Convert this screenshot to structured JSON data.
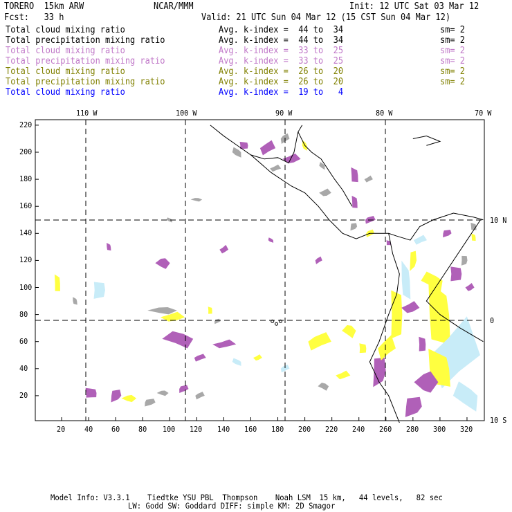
{
  "header": {
    "model": "TORERO  15km ARW",
    "org": "NCAR/MMM",
    "init": "Init: 12 UTC Sat 03 Mar 12",
    "fcst": "Fcst:   33 h",
    "valid": "Valid: 21 UTC Sun 04 Mar 12 (15 CST Sun 04 Mar 12)"
  },
  "legend": [
    {
      "field": "Total cloud mixing ratio",
      "range": "Avg. k-index =  44 to  34",
      "sm": "sm= 2",
      "color": "#000000"
    },
    {
      "field": "Total precipitation mixing ratio",
      "range": "Avg. k-index =  44 to  34",
      "sm": "sm= 2",
      "color": "#000000"
    },
    {
      "field": "Total cloud mixing ratio",
      "range": "Avg. k-index =  33 to  25",
      "sm": "sm= 2",
      "color": "#c078c8"
    },
    {
      "field": "Total precipitation mixing ratio",
      "range": "Avg. k-index =  33 to  25",
      "sm": "sm= 2",
      "color": "#c078c8"
    },
    {
      "field": "Total cloud mixing ratio",
      "range": "Avg. k-index =  26 to  20",
      "sm": "sm= 2",
      "color": "#808000"
    },
    {
      "field": "Total precipitation mixing ratio",
      "range": "Avg. k-index =  26 to  20",
      "sm": "sm= 2",
      "color": "#808000"
    },
    {
      "field": "Total cloud mixing ratio",
      "range": "Avg. k-index =  19 to   4",
      "sm": "",
      "color": "#0000ff"
    }
  ],
  "axes": {
    "x_ticks": [
      "20",
      "40",
      "60",
      "80",
      "100",
      "120",
      "140",
      "160",
      "180",
      "200",
      "220",
      "240",
      "260",
      "280",
      "300",
      "320"
    ],
    "y_ticks": [
      "20",
      "40",
      "60",
      "80",
      "100",
      "120",
      "140",
      "160",
      "180",
      "200",
      "220"
    ],
    "lon_labels": [
      "110 W",
      "100 W",
      "90 W",
      "80 W",
      "70 W"
    ],
    "lat_labels": [
      "10 N",
      "0",
      "10 S"
    ]
  },
  "colors": {
    "gray": "#a8a8a8",
    "purple": "#b060b8",
    "yellow": "#ffff40",
    "lightblue": "#c8ecf8"
  },
  "footer": {
    "line1": "Model Info: V3.3.1    Tiedtke YSU PBL  Thompson    Noah LSM  15 km,   44 levels,   82 sec",
    "line2": "LW: Godd SW: Goddard DIFF: simple KM: 2D Smagor"
  }
}
